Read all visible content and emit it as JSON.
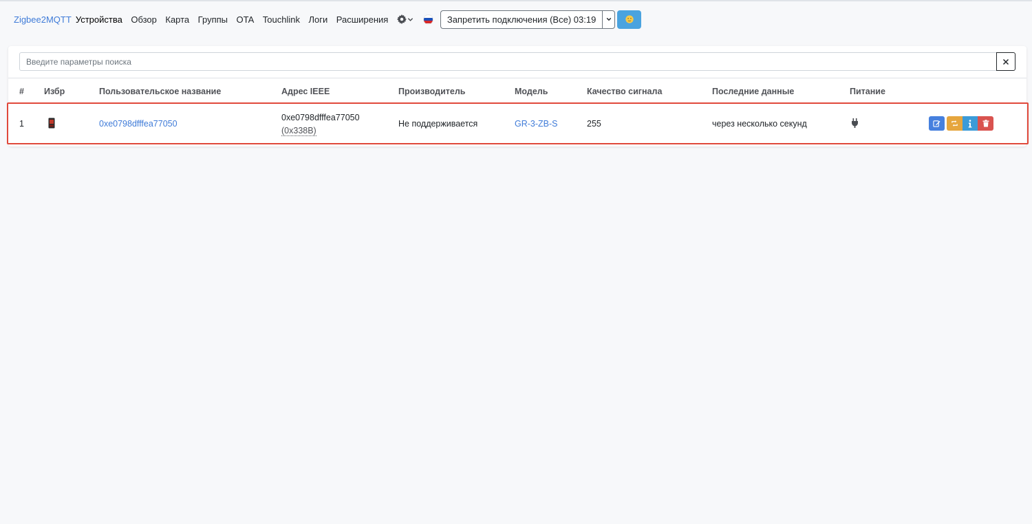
{
  "nav": {
    "brand": "Zigbee2MQTT",
    "items": [
      {
        "label": "Устройства"
      },
      {
        "label": "Обзор"
      },
      {
        "label": "Карта"
      },
      {
        "label": "Группы"
      },
      {
        "label": "OTA"
      },
      {
        "label": "Touchlink"
      },
      {
        "label": "Логи"
      },
      {
        "label": "Расширения"
      }
    ],
    "settings_icon": "gear-icon",
    "language_icon": "russian-flag-icon",
    "permit_join_label": "Запретить подключения (Все) 03:19",
    "theme_icon": "moon-face-icon"
  },
  "search": {
    "placeholder": "Введите параметры поиска",
    "value": "",
    "clear_icon": "close-icon"
  },
  "table": {
    "headers": {
      "index": "#",
      "favorite": "Избр",
      "friendly_name": "Пользовательское название",
      "ieee": "Адрес IEEE",
      "manufacturer": "Производитель",
      "model": "Модель",
      "lqi": "Качество сигнала",
      "last_seen": "Последние данные",
      "power": "Питание"
    },
    "rows": [
      {
        "index": "1",
        "image_icon": "device-thumbnail",
        "friendly_name": "0xe0798dfffea77050",
        "ieee": "0xe0798dfffea77050",
        "nwk": "(0x338B)",
        "manufacturer": "Не поддерживается",
        "model": "GR-3-ZB-S",
        "lqi": "255",
        "last_seen": "через несколько секунд",
        "power_icon": "plug-icon",
        "actions": [
          "edit-icon",
          "rename-icon",
          "info-icon",
          "trash-icon"
        ]
      }
    ]
  },
  "colors": {
    "link": "#3f7bd8",
    "highlight": "#e0483a",
    "edit": "#4680de",
    "rename": "#e6a63e",
    "info": "#3b9bd8",
    "delete": "#d9534f"
  }
}
